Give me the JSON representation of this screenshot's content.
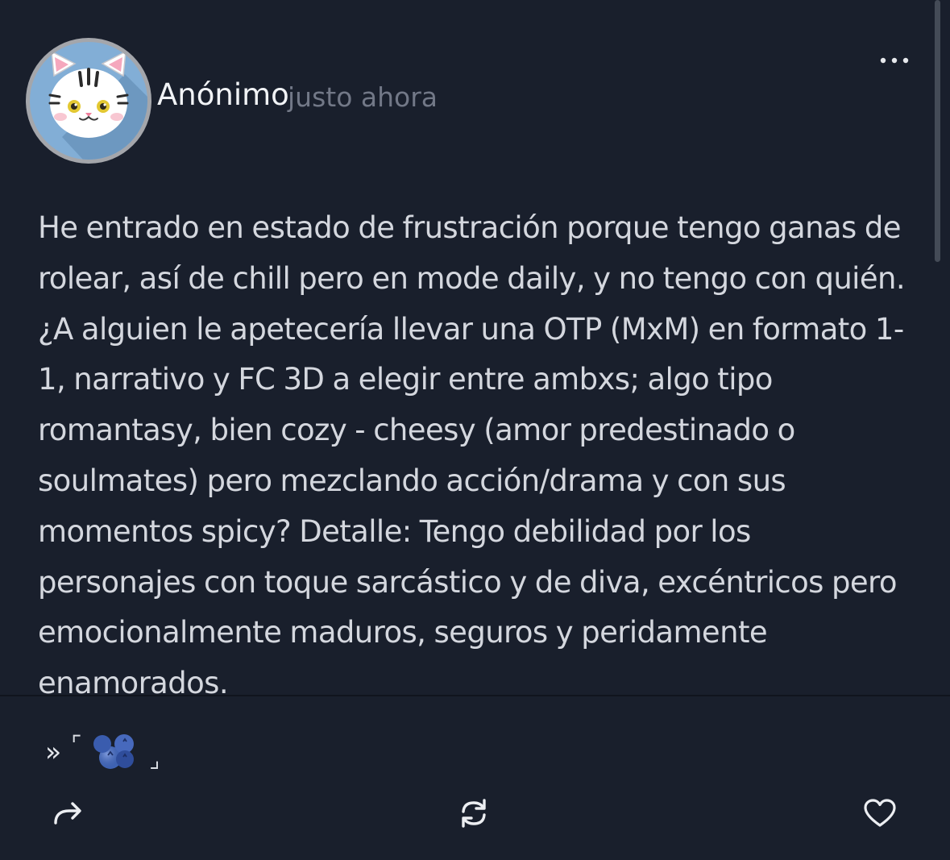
{
  "post": {
    "author": "Anónimo",
    "timestamp": "justo ahora",
    "body": "He entrado en estado de frustración porque tengo ganas de rolear, así de chill pero en mode daily, y no tengo con quién. ¿A alguien le apetecería llevar una OTP (MxM) en formato 1-1, narrativo y FC 3D a elegir entre ambxs; algo tipo romantasy, bien cozy - cheesy (amor predestinado o soulmates) pero mezclando acción/drama y con sus momentos spicy? Detalle: Tengo debilidad por los personajes con toque sarcástico y de diva, excéntricos pero emocionalmente maduros, seguros y peridamente enamorados.",
    "tag": {
      "prefix": "»",
      "open": "⌜",
      "close": "⌟",
      "emoji": "blueberries-icon"
    }
  },
  "actions": {
    "share": "share-arrow-icon",
    "reblog": "reblog-icon",
    "like": "heart-icon"
  },
  "colors": {
    "background": "#191f2c",
    "text": "#d4d7de",
    "muted": "#727887",
    "avatar_bg": "#82aed6"
  }
}
